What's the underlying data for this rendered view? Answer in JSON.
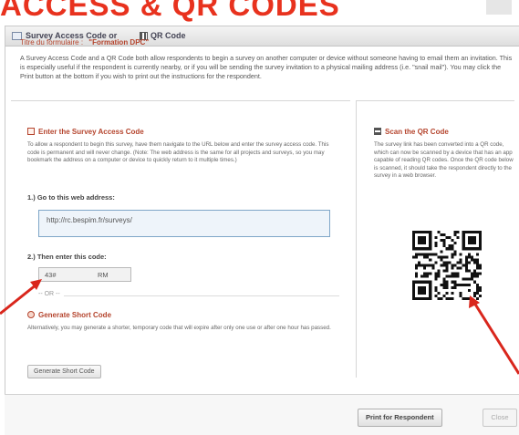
{
  "banner": {
    "text": "ACCESS & QR CODES"
  },
  "dialog": {
    "title_part1": "Survey Access Code or",
    "title_part2": "QR Code",
    "survey_title_label": "Titre du formulaire :",
    "survey_title_value": "\"Formation DPC\"",
    "intro": "A Survey Access Code and a QR Code both allow respondents to begin a survey on another computer or device without someone having to email them an invitation. This is especially useful if the respondent is currently nearby, or if you will be sending the survey invitation to a physical mailing address (i.e. \"snail mail\"). You may click the Print button at the bottom if you wish to print out the instructions for the respondent."
  },
  "access_code": {
    "heading": "Enter the Survey Access Code",
    "description": "To allow a respondent to begin this survey, have them navigate to the URL below and enter the survey access code. This code is permanent and will never change. (Note: The web address is the same for all projects and surveys, so you may bookmark the address on a computer or device to quickly return to it multiple times.)",
    "step1_label": "1.) Go to this web address:",
    "url": "http://rc.bespim.fr/surveys/",
    "step2_label": "2.) Then enter this code:",
    "code_left": "43#",
    "code_right": "RM",
    "or_text": "-- OR --"
  },
  "short_code": {
    "heading": "Generate Short Code",
    "description": "Alternatively, you may generate a shorter, temporary code that will expire after only one use or after one hour has passed.",
    "button_label": "Generate Short Code"
  },
  "qr": {
    "heading": "Scan the QR Code",
    "description": "The survey link has been converted into a QR code, which can now be scanned by a device that has an app capable of reading QR codes. Once the QR code below is scanned, it should take the respondent directly to the survey in a web browser."
  },
  "footer": {
    "print_label": "Print for Respondent",
    "close_label": "Close"
  },
  "colors": {
    "banner_red": "#e8321e",
    "heading_red": "#b5452e",
    "arrow_red": "#d9261c"
  },
  "icons": [
    "code-icon",
    "qr-icon",
    "generate-icon",
    "dialog-icon"
  ]
}
